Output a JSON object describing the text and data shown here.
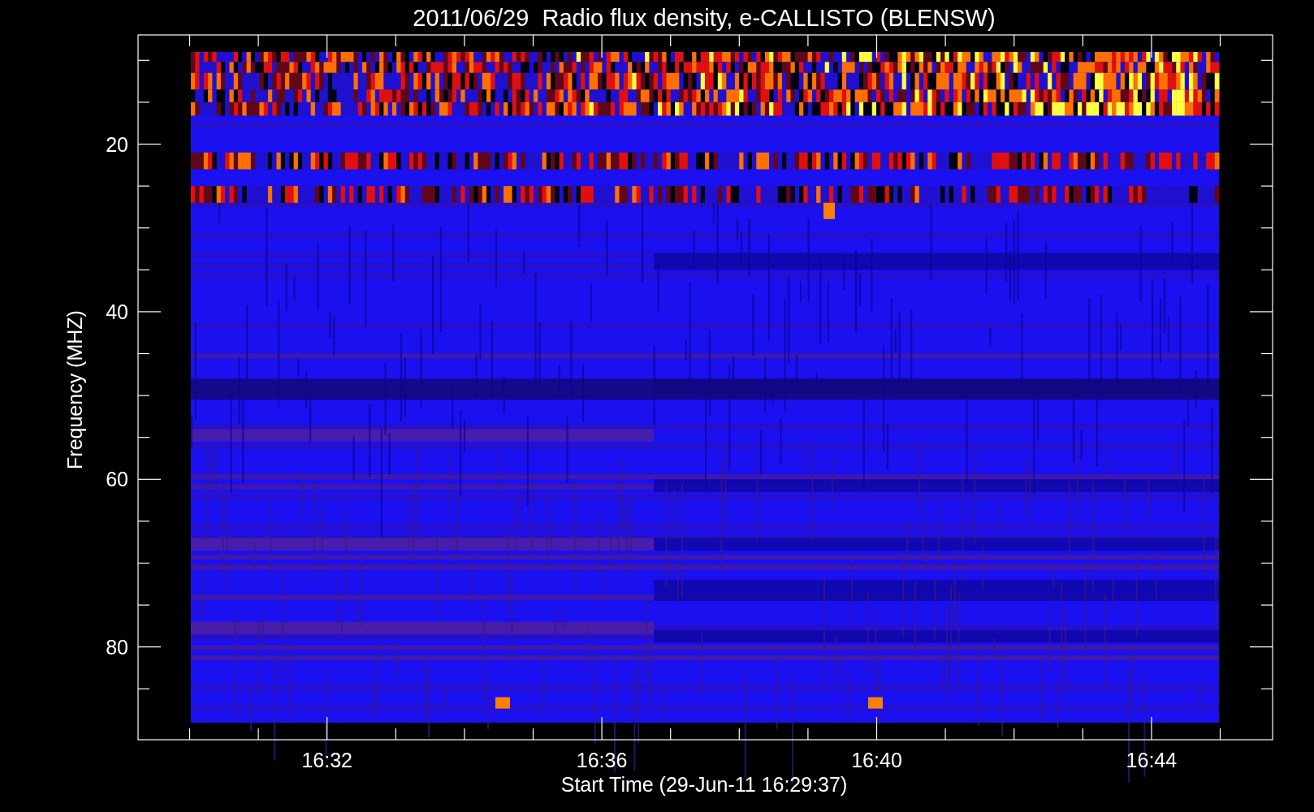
{
  "title": "2011/06/29  Radio flux density, e-CALLISTO (BLENSW)",
  "y_axis": {
    "label": "Frequency (MHZ)",
    "ticks": [
      "20",
      "40",
      "60",
      "80"
    ]
  },
  "x_axis": {
    "label": "Start Time (29-Jun-11 16:29:37)",
    "ticks": [
      "16:32",
      "16:36",
      "16:40",
      "16:44"
    ]
  }
}
